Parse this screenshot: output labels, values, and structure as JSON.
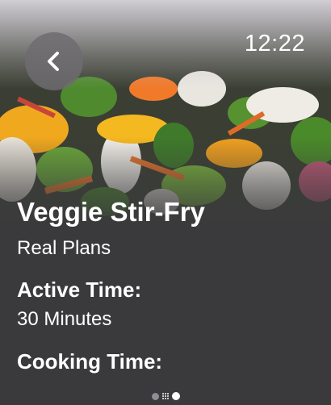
{
  "status": {
    "time": "12:22"
  },
  "navigation": {
    "back_icon": "chevron-left-icon"
  },
  "recipe": {
    "title": "Veggie Stir-Fry",
    "source": "Real Plans",
    "active_time_label": "Active Time:",
    "active_time_value": "30 Minutes",
    "cooking_time_label": "Cooking Time:"
  },
  "pager": {
    "page_count": 3,
    "current_page": 3
  },
  "colors": {
    "background": "#3a3a3c",
    "text": "#ffffff",
    "back_button": "#6e6c70"
  }
}
